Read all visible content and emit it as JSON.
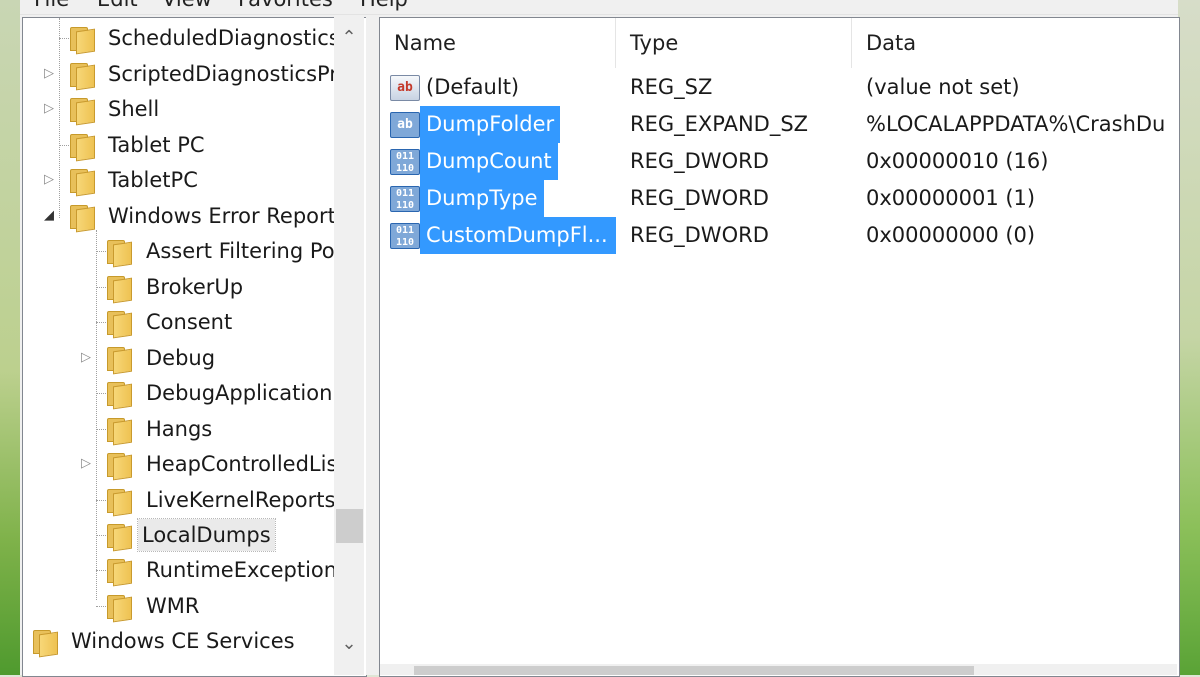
{
  "menu": [
    "File",
    "Edit",
    "View",
    "Favorites",
    "Help"
  ],
  "tree": {
    "items": [
      {
        "label": "ScheduledDiagnostics",
        "expander": ""
      },
      {
        "label": "ScriptedDiagnosticsPr",
        "expander": "▷"
      },
      {
        "label": "Shell",
        "expander": "▷"
      },
      {
        "label": "Tablet PC",
        "expander": ""
      },
      {
        "label": "TabletPC",
        "expander": "▷"
      },
      {
        "label": "Windows Error Report",
        "expander": "◢"
      },
      {
        "label": "Assert Filtering Po",
        "expander": ""
      },
      {
        "label": "BrokerUp",
        "expander": ""
      },
      {
        "label": "Consent",
        "expander": ""
      },
      {
        "label": "Debug",
        "expander": "▷"
      },
      {
        "label": "DebugApplication",
        "expander": ""
      },
      {
        "label": "Hangs",
        "expander": ""
      },
      {
        "label": "HeapControlledLis",
        "expander": "▷"
      },
      {
        "label": "LiveKernelReports",
        "expander": ""
      },
      {
        "label": "LocalDumps",
        "expander": "",
        "selected": true
      },
      {
        "label": "RuntimeException",
        "expander": ""
      },
      {
        "label": "WMR",
        "expander": ""
      },
      {
        "label": "Windows CE Services",
        "expander": ""
      }
    ],
    "scroll_up": "⌃",
    "scroll_down": "⌄"
  },
  "list": {
    "columns": [
      "Name",
      "Type",
      "Data"
    ],
    "rows": [
      {
        "name": "(Default)",
        "type": "REG_SZ",
        "data": "(value not set)",
        "icon": "string-value-icon",
        "selected": false
      },
      {
        "name": "DumpFolder",
        "type": "REG_EXPAND_SZ",
        "data": "%LOCALAPPDATA%\\CrashDu",
        "icon": "string-value-icon",
        "selected": true
      },
      {
        "name": "DumpCount",
        "type": "REG_DWORD",
        "data": "0x00000010 (16)",
        "icon": "binary-value-icon",
        "selected": true
      },
      {
        "name": "DumpType",
        "type": "REG_DWORD",
        "data": "0x00000001 (1)",
        "icon": "binary-value-icon",
        "selected": true
      },
      {
        "name": "CustomDumpFl...",
        "type": "REG_DWORD",
        "data": "0x00000000 (0)",
        "icon": "binary-value-icon",
        "selected": true
      }
    ]
  },
  "icons": {
    "string_glyph": "ab",
    "binary_glyph": "011\n110"
  },
  "colors": {
    "selection": "#3399ff",
    "folder": "#eec252"
  }
}
